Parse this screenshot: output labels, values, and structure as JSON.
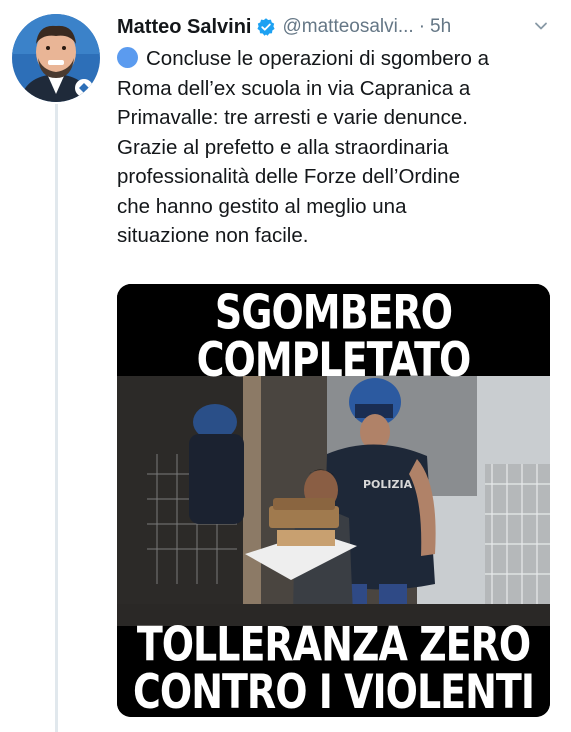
{
  "tweet": {
    "author_name": "Matteo Salvini",
    "handle": "@matteosalvi...",
    "separator": "·",
    "time": "5h",
    "text": "Concluse le operazioni di sgombero a\nRoma dell’ex scuola in via Capranica a\nPrimavalle: tre arresti e varie denunce.\nGrazie al prefetto e alla straordinaria\nprofessionalità delle Forze dell’Ordine\nche hanno gestito al meglio una\nsituazione non facile.",
    "media": {
      "caption_top": "SGOMBERO\nCOMPLETATO",
      "caption_bottom": "TOLLERANZA ZERO\nCONTRO I VIOLENTI",
      "vest_text": "POLIZIA"
    }
  },
  "colors": {
    "verified": "#1da1f2",
    "secondary_text": "#657786",
    "emoji_circle": "#5b9bef",
    "thread_line": "#e1e8ed"
  },
  "icons": [
    "verified-badge-icon",
    "blue-circle-emoji-icon",
    "chevron-down-icon"
  ]
}
